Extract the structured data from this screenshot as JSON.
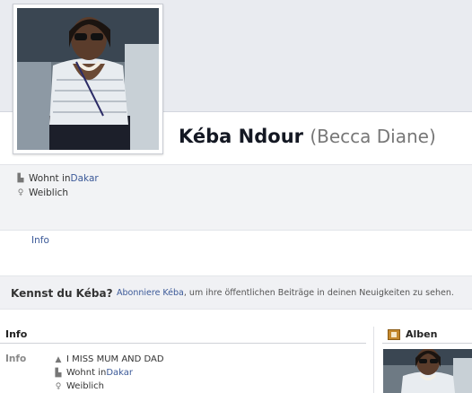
{
  "profile": {
    "name": "Kéba Ndour",
    "alternate_name": "(Becca Diane)",
    "facts": [
      {
        "icon": "home-icon",
        "prefix": "Wohnt in ",
        "link": "Dakar"
      },
      {
        "icon": "female-icon",
        "text": "Weiblich"
      }
    ]
  },
  "nav": {
    "info_tab": "Info"
  },
  "follow_prompt": {
    "title": "Kennst du Kéba?",
    "link": "Abonniere Kéba",
    "text": ", um ihre öffentlichen Beiträge in deinen Neuigkeiten zu sehen."
  },
  "info_section": {
    "heading": "Info",
    "label": "Info",
    "items": [
      {
        "icon": "person-icon",
        "text": "I MISS MUM AND DAD"
      },
      {
        "icon": "home-icon",
        "prefix": "Wohnt in ",
        "link": "Dakar"
      },
      {
        "icon": "female-icon",
        "text": "Weiblich"
      }
    ]
  },
  "albums": {
    "heading": "Alben"
  },
  "colors": {
    "link": "#3b5998",
    "cover": "#e9ebf0",
    "band": "#f2f3f5"
  }
}
